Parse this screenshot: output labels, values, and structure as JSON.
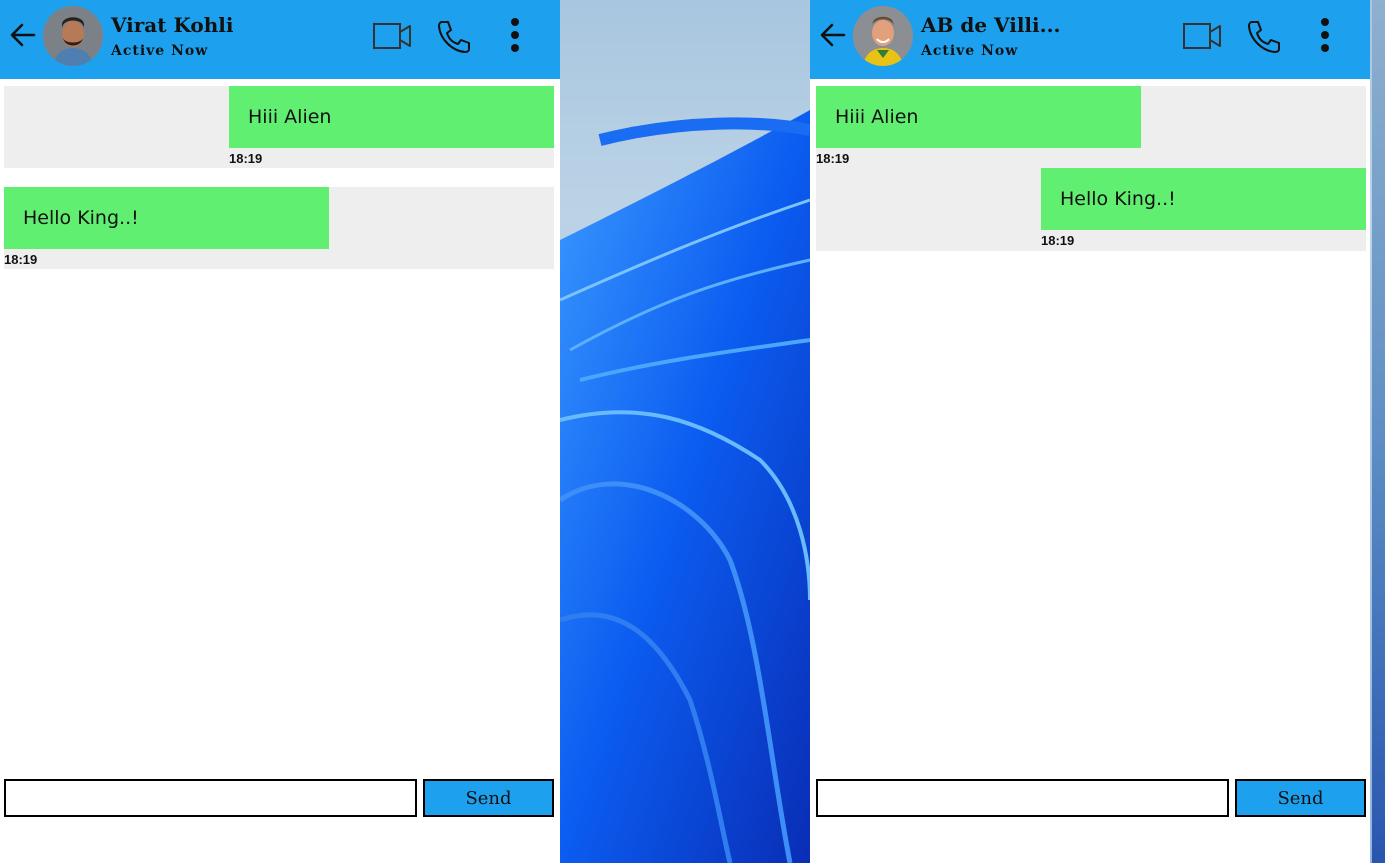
{
  "wallpaper": {
    "accent": "#1d6ff0"
  },
  "windows": [
    {
      "header": {
        "contact_name": "Virat Kohli",
        "status": "Active Now",
        "color": "#1da1ee"
      },
      "messages": [
        {
          "text": "Hiii Alien",
          "time": "18:19",
          "side": "right"
        },
        {
          "text": "Hello King..!",
          "time": "18:19",
          "side": "left"
        }
      ],
      "composer": {
        "value": "",
        "send_label": "Send"
      }
    },
    {
      "header": {
        "contact_name": "AB de Villi...",
        "status": "Active Now",
        "color": "#1da1ee"
      },
      "messages": [
        {
          "text": "Hiii Alien",
          "time": "18:19",
          "side": "left"
        },
        {
          "text": "Hello King..!",
          "time": "18:19",
          "side": "right"
        }
      ],
      "composer": {
        "value": "",
        "send_label": "Send"
      }
    }
  ],
  "colors": {
    "bubble": "#61ef71",
    "row_bg": "#eeeeee"
  },
  "icons": [
    "back-arrow-icon",
    "video-call-icon",
    "phone-icon",
    "more-vertical-icon"
  ]
}
